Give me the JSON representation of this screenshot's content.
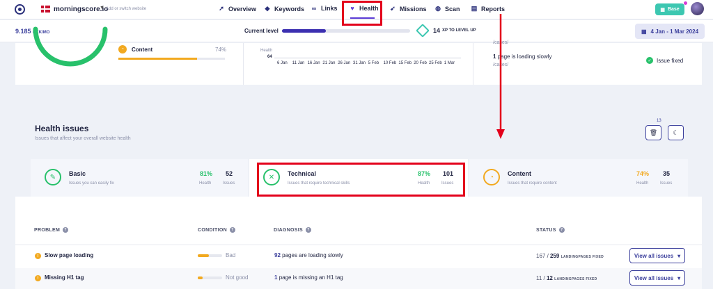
{
  "nav": {
    "site_name": "morningscore.io",
    "site_hint": "Add or switch website",
    "items": [
      {
        "label": "Overview",
        "icon": "rocket-icon"
      },
      {
        "label": "Keywords",
        "icon": "tag-icon"
      },
      {
        "label": "Links",
        "icon": "link-icon"
      },
      {
        "label": "Health",
        "icon": "heart-icon"
      },
      {
        "label": "Missions",
        "icon": "rocket-icon"
      },
      {
        "label": "Scan",
        "icon": "globe-icon"
      },
      {
        "label": "Reports",
        "icon": "document-icon"
      }
    ],
    "base_label": "Base"
  },
  "subbar": {
    "value": "9.185",
    "currency": "DKK/MO",
    "current_level_label": "Current level",
    "level_progress": 0.34,
    "xp_number": "14",
    "xp_text": "XP TO LEVEL UP",
    "date_range": "4 Jan - 1 Mar 2024"
  },
  "overview": {
    "content_label": "Content",
    "content_pct": "74%",
    "content_value": 0.74,
    "chart_axis_label": "Health",
    "chart_axis_value": "64",
    "chart_ticks": [
      "6 Jan",
      "11 Jan",
      "16 Jan",
      "21 Jan",
      "26 Jan",
      "31 Jan",
      "5 Feb",
      "10 Feb",
      "15 Feb",
      "20 Feb",
      "25 Feb",
      "1 Mar"
    ],
    "top_path": "/cases/",
    "slow_count": "1",
    "slow_text": "page is loading slowly",
    "slow_path": "/cases/",
    "fixed_label": "Issue fixed"
  },
  "health_issues": {
    "title": "Health issues",
    "subtitle": "Issues that affect your overall website health",
    "trash_badge": "13"
  },
  "cards": [
    {
      "title": "Basic",
      "subtitle": "Issues you can easily fix",
      "health": "81%",
      "issues": "52",
      "health_label": "Health",
      "issues_label": "Issues"
    },
    {
      "title": "Technical",
      "subtitle": "Issues that require technical skills",
      "health": "87%",
      "issues": "101",
      "health_label": "Health",
      "issues_label": "Issues"
    },
    {
      "title": "Content",
      "subtitle": "Issues that require content",
      "health": "74%",
      "issues": "35",
      "health_label": "Health",
      "issues_label": "Issues"
    }
  ],
  "table": {
    "headers": [
      "PROBLEM",
      "CONDITION",
      "DIAGNOSIS",
      "STATUS"
    ],
    "rows": [
      {
        "problem": "Slow page loading",
        "condition": "Bad",
        "condition_value": 0.45,
        "diag_count": "92",
        "diag_text": "pages are loading slowly",
        "fixed": "167",
        "total": "259",
        "status_suffix": "LANDINGPAGES FIXED",
        "button": "View all issues"
      },
      {
        "problem": "Missing H1 tag",
        "condition": "Not good",
        "condition_value": 0.2,
        "diag_count": "1",
        "diag_text": "page is missing an H1 tag",
        "fixed": "11",
        "total": "12",
        "status_suffix": "LANDINGPAGES FIXED",
        "button": "View all issues"
      }
    ]
  },
  "colors": {
    "accent": "#3b3f9c",
    "good": "#28c16b",
    "warn": "#f2a91f",
    "highlight": "#e3001b"
  }
}
